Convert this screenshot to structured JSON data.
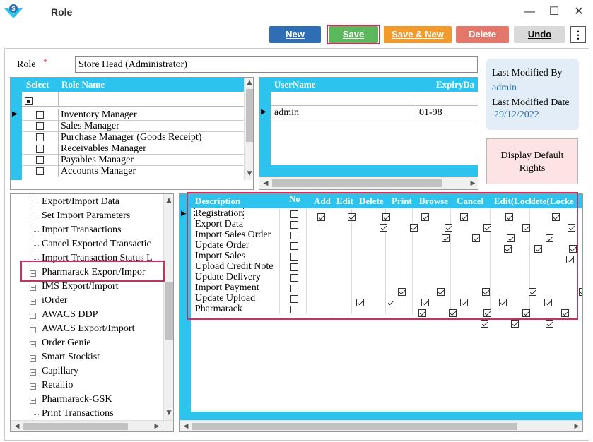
{
  "window": {
    "title": "Role",
    "minimize": "—",
    "maximize": "☐",
    "close": "✕"
  },
  "toolbar": {
    "new_label": "New",
    "save_label": "Save",
    "save_new_label": "Save & New",
    "delete_label": "Delete",
    "undo_label": "Undo",
    "more_label": "⋮"
  },
  "role": {
    "label": "Role",
    "required_mark": "*",
    "value": "Store Head (Administrator)"
  },
  "roles_grid": {
    "columns": [
      "Select",
      "Role Name"
    ],
    "rows": [
      {
        "name": "Inventory Manager",
        "selected": false
      },
      {
        "name": "Sales Manager",
        "selected": false
      },
      {
        "name": "Purchase Manager (Goods Receipt)",
        "selected": false
      },
      {
        "name": "Receivables Manager",
        "selected": false
      },
      {
        "name": "Payables Manager",
        "selected": false
      },
      {
        "name": "Accounts Manager",
        "selected": false
      }
    ]
  },
  "users_grid": {
    "columns": [
      "UserName",
      "ExpiryDa"
    ],
    "rows": [
      {
        "username": "admin",
        "expiry": "01-98"
      }
    ]
  },
  "info": {
    "last_modified_by_label": "Last Modified By",
    "last_modified_by": "admin",
    "last_modified_date_label": "Last Modified Date",
    "last_modified_date": "29/12/2022"
  },
  "display_default_rights": {
    "line1": "Display Default",
    "line2": "Rights"
  },
  "tree": {
    "items": [
      {
        "label": "Export/Import Data",
        "expandable": false
      },
      {
        "label": "Set Import Parameters",
        "expandable": false
      },
      {
        "label": "Import Transactions",
        "expandable": false
      },
      {
        "label": "Cancel Exported Transactic",
        "expandable": false
      },
      {
        "label": "Import Transaction Status L",
        "expandable": false
      },
      {
        "label": "Pharmarack Export/Impor",
        "expandable": true
      },
      {
        "label": "IMS Export/Import",
        "expandable": true
      },
      {
        "label": "iOrder",
        "expandable": true
      },
      {
        "label": "AWACS DDP",
        "expandable": true
      },
      {
        "label": "AWACS Export/Import",
        "expandable": true
      },
      {
        "label": "Order Genie",
        "expandable": true
      },
      {
        "label": "Smart Stockist",
        "expandable": true
      },
      {
        "label": "Capillary",
        "expandable": true
      },
      {
        "label": "Retailio",
        "expandable": true
      },
      {
        "label": "Pharmarack-GSK",
        "expandable": true
      },
      {
        "label": "Print Transactions",
        "expandable": false
      }
    ]
  },
  "rights_grid": {
    "columns": [
      "Description",
      "No",
      "Add",
      "Edit",
      "Delete",
      "Print",
      "Browse",
      "Cancel",
      "Edit(Lock",
      "lete(Locke"
    ],
    "rows": [
      {
        "description": "Registration",
        "no": false,
        "rights": [
          true,
          true,
          true,
          true,
          true,
          true,
          true,
          true
        ]
      },
      {
        "description": "Export Data",
        "no": false,
        "rights": [
          true,
          true,
          true,
          true,
          true,
          true,
          true,
          true
        ]
      },
      {
        "description": "Import Sales Order",
        "no": false,
        "rights": [
          true,
          true,
          true,
          true,
          true,
          true,
          true,
          true
        ]
      },
      {
        "description": "Update Order",
        "no": false,
        "rights": [
          true,
          true,
          true,
          true,
          true,
          true,
          true,
          true
        ]
      },
      {
        "description": "Import Sales",
        "no": false,
        "rights": [
          true,
          true,
          true,
          true,
          true,
          true,
          true,
          true
        ]
      },
      {
        "description": "Upload Credit Note",
        "no": false,
        "rights": [
          true,
          true,
          true,
          true,
          true,
          true,
          true,
          true
        ]
      },
      {
        "description": "Update Delivery",
        "no": false,
        "rights": [
          true,
          true,
          true,
          true,
          true,
          true,
          true,
          true
        ]
      },
      {
        "description": "Import Payment",
        "no": false,
        "rights": [
          true,
          true,
          true,
          true,
          true,
          true,
          true,
          true
        ]
      },
      {
        "description": "Update Upload",
        "no": false,
        "rights": [
          true,
          true,
          true,
          true,
          true,
          true,
          true,
          true
        ]
      },
      {
        "description": "Pharmarack",
        "no": false,
        "rights": [
          true,
          true,
          true,
          true,
          true,
          true,
          true,
          true
        ]
      }
    ]
  },
  "colors": {
    "header": "#2cc4ef",
    "new": "#2f6db4",
    "save": "#5cb85c",
    "save_new": "#f39a2c",
    "delete": "#e5776a",
    "highlight": "#e0245e"
  }
}
